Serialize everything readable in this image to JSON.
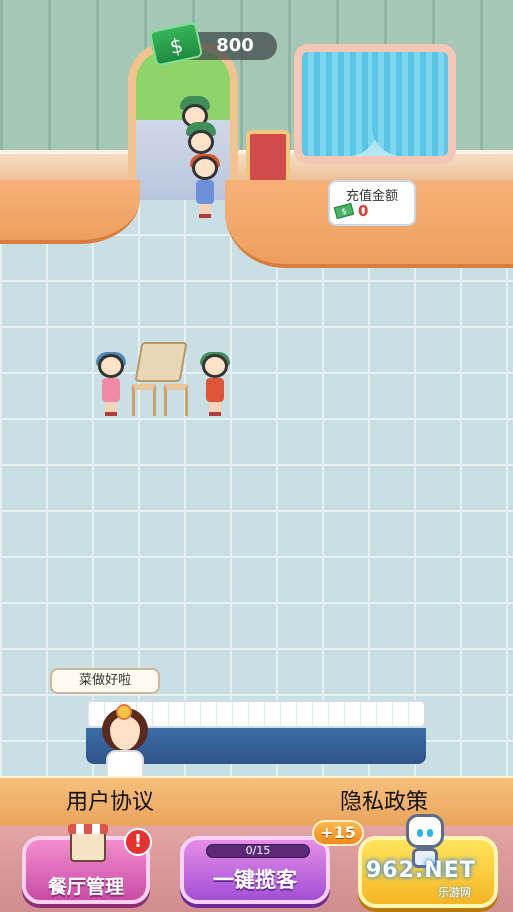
{
  "hud": {
    "money_value": "800",
    "money_icon": "cash-stack-icon"
  },
  "recharge": {
    "title": "充值金额",
    "value": "0",
    "icon": "cash-icon"
  },
  "speech_bubble": {
    "text": "菜做好啦"
  },
  "links": {
    "user_agreement": "用户协议",
    "privacy_policy": "隐私政策"
  },
  "buttons": {
    "restaurant_manage": {
      "label": "餐厅管理",
      "alert": "!"
    },
    "invite_customers": {
      "label": "一键揽客",
      "progress_text": "0/15",
      "progress_fraction": 0,
      "bonus": "+15"
    },
    "gold": {
      "icon": "robot-icon"
    }
  },
  "watermark": {
    "main": "962.NET",
    "sub": "乐游网"
  },
  "colors": {
    "floor": "#c9dfe4",
    "counter": "#f6b178",
    "bottom_bar": "#e3a4a4",
    "manage_button": "#f38fcf",
    "invite_button": "#a24fd6",
    "gold_button": "#f4b623",
    "money_text": "#ffffff",
    "recharge_value": "#e23a2e"
  }
}
